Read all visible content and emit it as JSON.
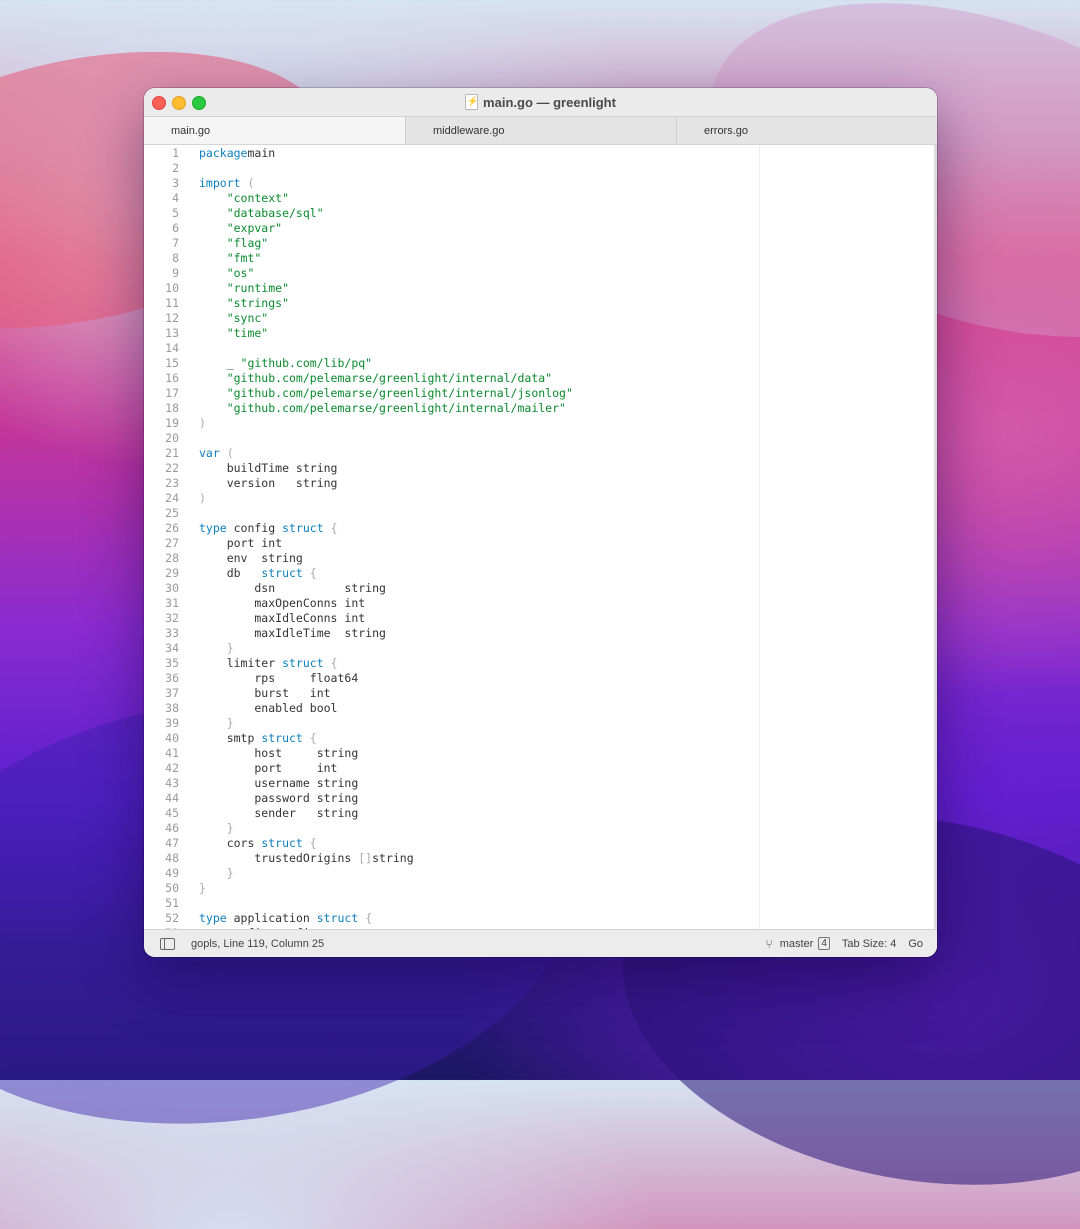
{
  "window": {
    "title": "main.go — greenlight"
  },
  "tabs": [
    {
      "label": "main.go",
      "active": true
    },
    {
      "label": "middleware.go",
      "active": false
    },
    {
      "label": "errors.go",
      "active": false
    }
  ],
  "code_lines": [
    [
      [
        "kw",
        "package"
      ],
      [
        "",
        "main"
      ]
    ],
    [],
    [
      [
        "kw",
        "import"
      ],
      [
        "punc",
        " ("
      ]
    ],
    [
      [
        "str",
        "    \"context\""
      ]
    ],
    [
      [
        "str",
        "    \"database/sql\""
      ]
    ],
    [
      [
        "str",
        "    \"expvar\""
      ]
    ],
    [
      [
        "str",
        "    \"flag\""
      ]
    ],
    [
      [
        "str",
        "    \"fmt\""
      ]
    ],
    [
      [
        "str",
        "    \"os\""
      ]
    ],
    [
      [
        "str",
        "    \"runtime\""
      ]
    ],
    [
      [
        "str",
        "    \"strings\""
      ]
    ],
    [
      [
        "str",
        "    \"sync\""
      ]
    ],
    [
      [
        "str",
        "    \"time\""
      ]
    ],
    [],
    [
      [
        "",
        "    _ "
      ],
      [
        "str",
        "\"github.com/lib/pq\""
      ]
    ],
    [
      [
        "str",
        "    \"github.com/pelemarse/greenlight/internal/data\""
      ]
    ],
    [
      [
        "str",
        "    \"github.com/pelemarse/greenlight/internal/jsonlog\""
      ]
    ],
    [
      [
        "str",
        "    \"github.com/pelemarse/greenlight/internal/mailer\""
      ]
    ],
    [
      [
        "punc",
        ")"
      ]
    ],
    [],
    [
      [
        "kw",
        "var"
      ],
      [
        "punc",
        " ("
      ]
    ],
    [
      [
        "",
        "    buildTime string"
      ]
    ],
    [
      [
        "",
        "    version   string"
      ]
    ],
    [
      [
        "punc",
        ")"
      ]
    ],
    [],
    [
      [
        "kw",
        "type"
      ],
      [
        "",
        " config "
      ],
      [
        "kw",
        "struct"
      ],
      [
        "punc",
        " {"
      ]
    ],
    [
      [
        "",
        "    port int"
      ]
    ],
    [
      [
        "",
        "    env  string"
      ]
    ],
    [
      [
        "",
        "    db   "
      ],
      [
        "kw",
        "struct"
      ],
      [
        "punc",
        " {"
      ]
    ],
    [
      [
        "",
        "        dsn          string"
      ]
    ],
    [
      [
        "",
        "        maxOpenConns int"
      ]
    ],
    [
      [
        "",
        "        maxIdleConns int"
      ]
    ],
    [
      [
        "",
        "        maxIdleTime  string"
      ]
    ],
    [
      [
        "punc",
        "    }"
      ]
    ],
    [
      [
        "",
        "    limiter "
      ],
      [
        "kw",
        "struct"
      ],
      [
        "punc",
        " {"
      ]
    ],
    [
      [
        "",
        "        rps     float64"
      ]
    ],
    [
      [
        "",
        "        burst   int"
      ]
    ],
    [
      [
        "",
        "        enabled bool"
      ]
    ],
    [
      [
        "punc",
        "    }"
      ]
    ],
    [
      [
        "",
        "    smtp "
      ],
      [
        "kw",
        "struct"
      ],
      [
        "punc",
        " {"
      ]
    ],
    [
      [
        "",
        "        host     string"
      ]
    ],
    [
      [
        "",
        "        port     int"
      ]
    ],
    [
      [
        "",
        "        username string"
      ]
    ],
    [
      [
        "",
        "        password string"
      ]
    ],
    [
      [
        "",
        "        sender   string"
      ]
    ],
    [
      [
        "punc",
        "    }"
      ]
    ],
    [
      [
        "",
        "    cors "
      ],
      [
        "kw",
        "struct"
      ],
      [
        "punc",
        " {"
      ]
    ],
    [
      [
        "",
        "        trustedOrigins "
      ],
      [
        "punc",
        "[]"
      ],
      [
        "",
        "string"
      ]
    ],
    [
      [
        "punc",
        "    }"
      ]
    ],
    [
      [
        "punc",
        "}"
      ]
    ],
    [],
    [
      [
        "kw",
        "type"
      ],
      [
        "",
        " application "
      ],
      [
        "kw",
        "struct"
      ],
      [
        "punc",
        " {"
      ]
    ],
    [
      [
        "",
        "    config config"
      ]
    ]
  ],
  "status": {
    "left": "gopls, Line 119, Column 25",
    "branch": "master",
    "branch_badge": "4",
    "tab_size": "Tab Size: 4",
    "language": "Go"
  }
}
